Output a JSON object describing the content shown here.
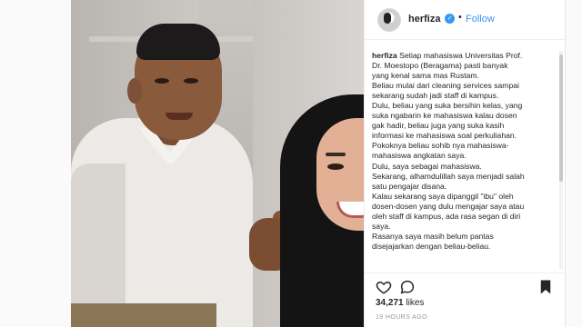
{
  "post": {
    "username": "herfiza",
    "verified_mark": "✓",
    "separator": "•",
    "follow_label": "Follow"
  },
  "caption": {
    "owner": "herfiza",
    "lines": [
      "Setiap mahasiswa Universitas Prof.",
      "Dr. Moestopo (Beragama) pasti banyak",
      "yang kenal sama mas Rustam.",
      "Beliau mulai dari cleaning services sampai",
      "sekarang sudah jadi staff di kampus.",
      "Dulu, beliau yang suka bersihin kelas, yang",
      "suka ngabarin ke mahasiswa kalau dosen",
      "gak hadir, beliau juga yang suka kasih",
      "informasi ke mahasiswa soal perkuliahan.",
      "Pokoknya beliau sohib nya mahasiswa-",
      "mahasiswa angkatan saya.",
      "Dulu, saya sebagai mahasiswa.",
      "Sekarang, alhamdulillah saya menjadi salah",
      "satu pengajar disana.",
      "Kalau sekarang saya dipanggil \"ibu\" oleh",
      "dosen-dosen yang dulu mengajar saya atau",
      "oleh staff di kampus, ada rasa segan di diri",
      "saya.",
      "Rasanya saya masih belum pantas",
      "disejajarkan dengan beliau-beliau."
    ]
  },
  "stats": {
    "likes_count": "34,271",
    "likes_label": "likes",
    "time_ago": "19 HOURS AGO"
  },
  "icons": [
    "heart-icon",
    "comment-icon",
    "bookmark-icon",
    "verified-badge-icon"
  ],
  "colors": {
    "link": "#3897f0",
    "text": "#262626",
    "muted": "#999999"
  }
}
